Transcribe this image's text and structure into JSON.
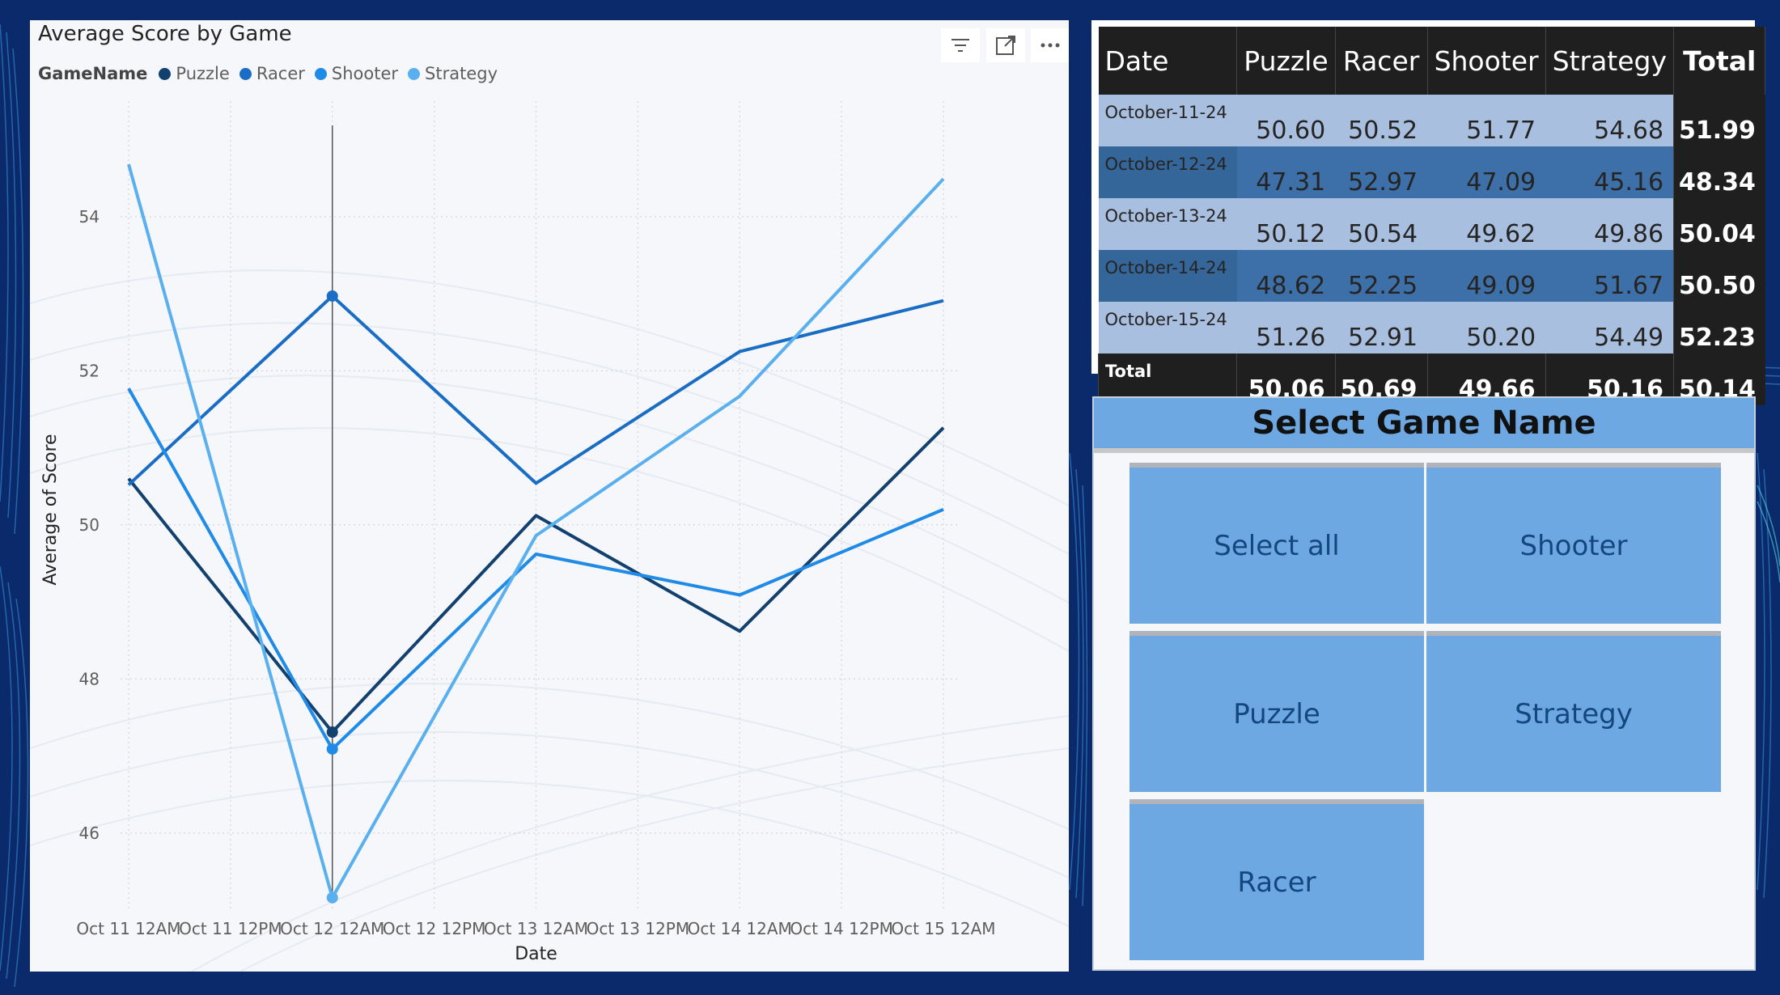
{
  "chart": {
    "title": "Average Score by Game",
    "legend_title": "GameName",
    "toolbar": {
      "filter_icon": "filter-icon",
      "focus_icon": "focus-mode-icon",
      "more_icon": "more-options-icon"
    }
  },
  "chart_data": {
    "type": "line",
    "title": "Average Score by Game",
    "xlabel": "Date",
    "ylabel": "Average of Score",
    "x_ticks": [
      "Oct 11 12AM",
      "Oct 11 12PM",
      "Oct 12 12AM",
      "Oct 12 12PM",
      "Oct 13 12AM",
      "Oct 13 12PM",
      "Oct 14 12AM",
      "Oct 14 12PM",
      "Oct 15 12AM"
    ],
    "y_ticks": [
      "46",
      "48",
      "50",
      "52",
      "54"
    ],
    "ylim": [
      45.0,
      55.5
    ],
    "x": [
      "2024-10-11",
      "2024-10-12",
      "2024-10-13",
      "2024-10-14",
      "2024-10-15"
    ],
    "legend_position": "top-left",
    "grid": true,
    "highlighted_x": "2024-10-12",
    "series": [
      {
        "name": "Puzzle",
        "color": "#12406f",
        "values": [
          50.6,
          47.31,
          50.12,
          48.62,
          51.26
        ]
      },
      {
        "name": "Racer",
        "color": "#1a6dc4",
        "values": [
          50.52,
          52.97,
          50.54,
          52.25,
          52.91
        ]
      },
      {
        "name": "Shooter",
        "color": "#1f8be6",
        "values": [
          51.77,
          47.09,
          49.62,
          49.09,
          50.2
        ]
      },
      {
        "name": "Strategy",
        "color": "#5ab0ef",
        "values": [
          54.68,
          45.16,
          49.86,
          51.67,
          54.49
        ]
      }
    ]
  },
  "table": {
    "headers": [
      "Date",
      "Puzzle",
      "Racer",
      "Shooter",
      "Strategy",
      "Total"
    ],
    "rows": [
      {
        "date": "October-11-24",
        "puzzle": "50.60",
        "racer": "50.52",
        "shooter": "51.77",
        "strategy": "54.68",
        "total": "51.99"
      },
      {
        "date": "October-12-24",
        "puzzle": "47.31",
        "racer": "52.97",
        "shooter": "47.09",
        "strategy": "45.16",
        "total": "48.34"
      },
      {
        "date": "October-13-24",
        "puzzle": "50.12",
        "racer": "50.54",
        "shooter": "49.62",
        "strategy": "49.86",
        "total": "50.04"
      },
      {
        "date": "October-14-24",
        "puzzle": "48.62",
        "racer": "52.25",
        "shooter": "49.09",
        "strategy": "51.67",
        "total": "50.50"
      },
      {
        "date": "October-15-24",
        "puzzle": "51.26",
        "racer": "52.91",
        "shooter": "50.20",
        "strategy": "54.49",
        "total": "52.23"
      }
    ],
    "total_row": {
      "label": "Total",
      "puzzle": "50.06",
      "racer": "50.69",
      "shooter": "49.66",
      "strategy": "50.16",
      "total": "50.14"
    }
  },
  "slicer": {
    "title": "Select Game Name",
    "options": [
      "Select all",
      "Shooter",
      "Puzzle",
      "Strategy",
      "Racer"
    ]
  }
}
